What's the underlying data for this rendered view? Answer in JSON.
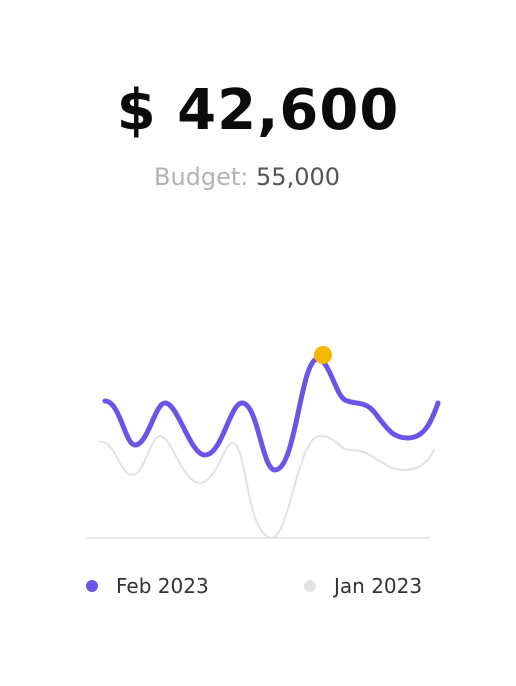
{
  "header": {
    "amount": "$ 42,600",
    "budget_label": "Budget:",
    "budget_value": "55,000"
  },
  "colors": {
    "primary_series": "#6a55e8",
    "secondary_series": "#e2e2e2",
    "highlight": "#f5b800",
    "baseline": "#e6e6e6",
    "legend_secondary_dot": "#e2e2e2"
  },
  "legend": {
    "items": [
      {
        "label": "Feb 2023",
        "color": "#6a55e8"
      },
      {
        "label": "Jan 2023",
        "color": "#e2e2e2"
      }
    ]
  },
  "chart_data": {
    "type": "line",
    "title": "",
    "xlabel": "",
    "ylabel": "",
    "grid": false,
    "legend_position": "bottom",
    "x": [
      0,
      1,
      2,
      3,
      4,
      5,
      6,
      7,
      8,
      9,
      10,
      11,
      12,
      13,
      14,
      15,
      16
    ],
    "ylim": [
      0,
      100
    ],
    "series": [
      {
        "name": "Feb 2023",
        "color": "#6a55e8",
        "values": [
          68,
          50,
          68,
          44,
          68,
          36,
          95,
          70,
          68,
          52,
          68,
          50,
          68,
          44,
          68,
          36,
          70
        ]
      },
      {
        "name": "Jan 2023",
        "color": "#e2e2e2",
        "values": [
          48,
          31,
          50,
          28,
          48,
          0,
          52,
          46,
          42,
          38,
          40,
          32,
          40,
          30,
          40,
          26,
          44
        ]
      }
    ],
    "highlight_point": {
      "series": "Feb 2023",
      "x": 6,
      "y": 95,
      "color": "#f5b800"
    }
  }
}
